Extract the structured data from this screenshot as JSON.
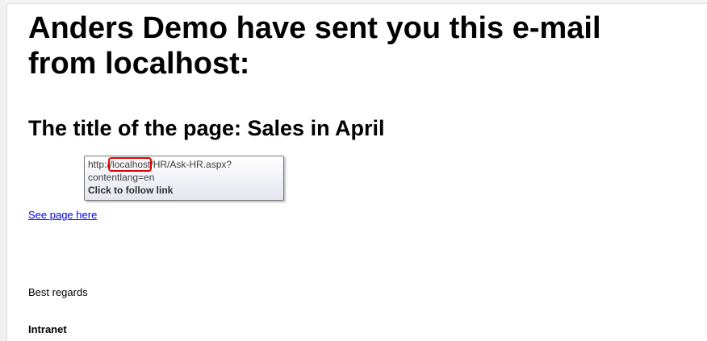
{
  "email": {
    "heading_line1": "Anders Demo have sent you this e-mail",
    "heading_line2": "from localhost:",
    "page_title_line": "The title of the page: Sales in April",
    "link_text": "See page here",
    "closing": "Best regards",
    "signature": "Intranet"
  },
  "tooltip": {
    "url_prefix": "http:/",
    "url_host": "/localhost",
    "url_suffix": "/HR/Ask-HR.aspx?",
    "url_line2": "contentlang=en",
    "action": "Click to follow link",
    "highlight_color": "#e00000"
  },
  "colors": {
    "link": "#0000ee"
  }
}
